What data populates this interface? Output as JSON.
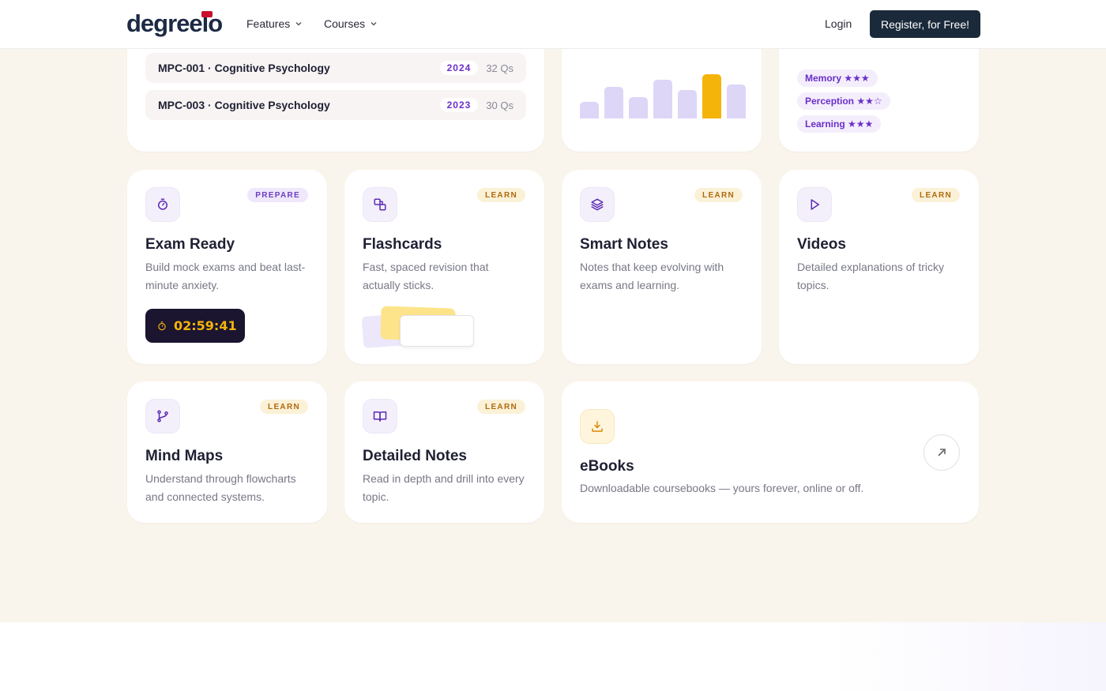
{
  "header": {
    "logo": "degreelo",
    "nav": [
      {
        "label": "Features"
      },
      {
        "label": "Courses"
      }
    ],
    "login": "Login",
    "register": "Register, for Free!"
  },
  "papers": [
    {
      "name": "MPC-001 · Cognitive Psychology",
      "year": "2024",
      "count": "32 Qs"
    },
    {
      "name": "MPC-003 · Cognitive Psychology",
      "year": "2023",
      "count": "30 Qs"
    }
  ],
  "progress_bars": [
    0.38,
    0.72,
    0.48,
    0.88,
    0.64,
    1.0,
    0.76
  ],
  "topics": [
    {
      "label": "Memory ★★★"
    },
    {
      "label": "Perception ★★☆"
    },
    {
      "label": "Learning ★★★"
    }
  ],
  "features": [
    {
      "badge": "PREPARE",
      "title": "Exam Ready",
      "desc": "Build mock exams and beat last-minute anxiety.",
      "icon": "stopwatch-icon"
    },
    {
      "badge": "LEARN",
      "title": "Flashcards",
      "desc": "Fast, spaced revision that actually sticks.",
      "icon": "flashcards-icon"
    },
    {
      "badge": "LEARN",
      "title": "Smart Notes",
      "desc": "Notes that keep evolving with exams and learning.",
      "icon": "layers-icon"
    },
    {
      "badge": "LEARN",
      "title": "Videos",
      "desc": "Detailed explanations of tricky topics.",
      "icon": "play-icon"
    },
    {
      "badge": "LEARN",
      "title": "Mind Maps",
      "desc": "Understand through flowcharts and connected systems.",
      "icon": "branch-icon"
    },
    {
      "badge": "LEARN",
      "title": "Detailed Notes",
      "desc": "Read in depth and drill into every topic.",
      "icon": "open-book-icon"
    }
  ],
  "timer": "02:59:41",
  "ebooks": {
    "title": "eBooks",
    "desc": "Downloadable coursebooks — yours forever, online or off."
  },
  "colors": {
    "accent": "#6b2fc9",
    "highlight": "#f5b40a",
    "dark": "#1b2a3a",
    "section_bg": "#faf5ec"
  }
}
